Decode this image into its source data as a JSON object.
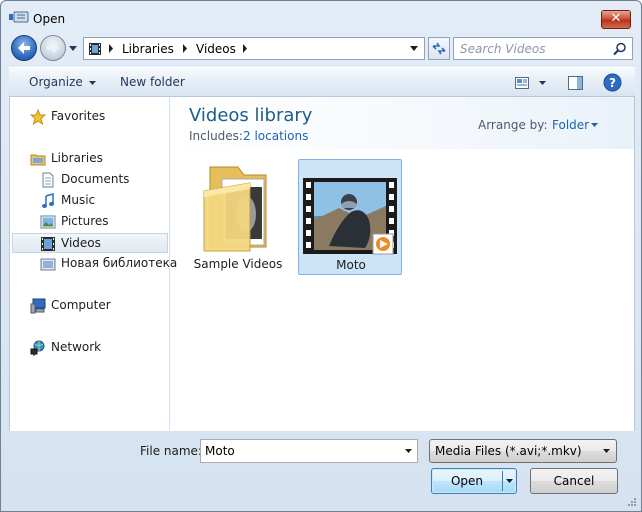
{
  "window": {
    "title": "Open",
    "close_label": "✕"
  },
  "address": {
    "crumbs": [
      "Libraries",
      "Videos"
    ]
  },
  "search": {
    "placeholder": "Search Videos"
  },
  "toolbar": {
    "organize_label": "Organize",
    "new_folder_label": "New folder"
  },
  "nav": {
    "items": [
      {
        "label": "Favorites",
        "icon": "star-icon"
      },
      {
        "label": "Libraries",
        "icon": "libraries-icon"
      },
      {
        "label": "Documents",
        "icon": "documents-icon"
      },
      {
        "label": "Music",
        "icon": "music-icon"
      },
      {
        "label": "Pictures",
        "icon": "pictures-icon"
      },
      {
        "label": "Videos",
        "icon": "videos-icon",
        "selected": true
      },
      {
        "label": "Новая библиотека",
        "icon": "library-icon"
      },
      {
        "label": "Computer",
        "icon": "computer-icon"
      },
      {
        "label": "Network",
        "icon": "network-icon"
      }
    ]
  },
  "library": {
    "title": "Videos library",
    "includes_label": "Includes:",
    "locations_label": "2 locations",
    "arrange_label": "Arrange by:",
    "arrange_value": "Folder"
  },
  "files": [
    {
      "label": "Sample Videos",
      "type": "folder"
    },
    {
      "label": "Moto",
      "type": "video",
      "selected": true
    }
  ],
  "bottom": {
    "file_name_label": "File name:",
    "file_name_value": "Moto",
    "filter_label": "Media Files (*.avi;*.mkv)",
    "open_label": "Open",
    "cancel_label": "Cancel"
  }
}
